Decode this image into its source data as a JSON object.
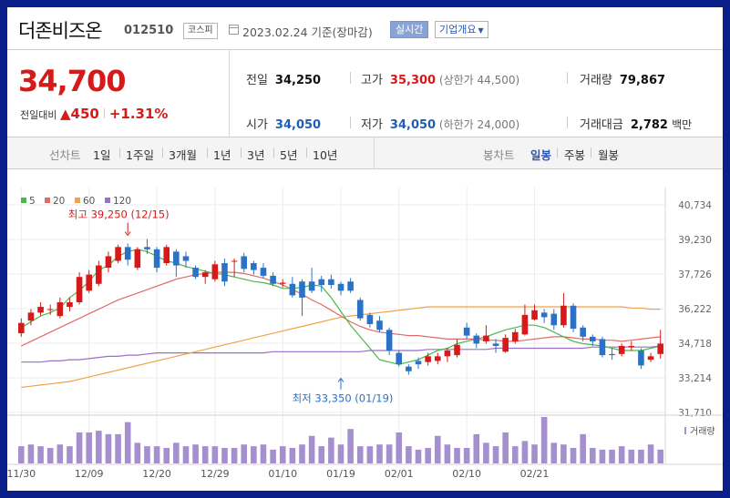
{
  "header": {
    "name": "더존비즈온",
    "code": "012510",
    "market": "코스피",
    "date_text": "2023.02.24 기준(장마감)",
    "realtime_label": "실시간",
    "company_label": "기업개요"
  },
  "quote": {
    "price": "34,700",
    "change_label": "전일대비",
    "change_arrow": "▲",
    "change_value": "450",
    "change_pct": "+1.31%",
    "prev_close_label": "전일",
    "prev_close": "34,250",
    "high_label": "고가",
    "high": "35,300",
    "upper_limit_label": "상한가",
    "upper_limit": "44,500",
    "volume_label": "거래량",
    "volume": "79,867",
    "open_label": "시가",
    "open": "34,050",
    "low_label": "저가",
    "low": "34,050",
    "lower_limit_label": "하한가",
    "lower_limit": "24,000",
    "amount_label": "거래대금",
    "amount": "2,782",
    "amount_unit": "백만"
  },
  "periods": {
    "label": "선차트",
    "items": [
      "1일",
      "1주일",
      "3개월",
      "1년",
      "3년",
      "5년",
      "10년"
    ]
  },
  "candle_periods": {
    "label": "봉차트",
    "items": [
      "일봉",
      "주봉",
      "월봉"
    ],
    "selected": "일봉"
  },
  "colors": {
    "up": "#d61a1a",
    "down": "#2b72c7",
    "ma5": "#4bb84b",
    "ma20": "#e06a6a",
    "ma60": "#f0a24a",
    "ma120": "#9a6fc8",
    "volume": "#a68fcf"
  },
  "chart_data": {
    "type": "candlestick",
    "legend": [
      {
        "name": "5",
        "color": "#4bb84b"
      },
      {
        "name": "20",
        "color": "#e06a6a"
      },
      {
        "name": "60",
        "color": "#f0a24a"
      },
      {
        "name": "120",
        "color": "#9a6fc8"
      }
    ],
    "y_ticks": [
      "40,734",
      "39,230",
      "37,726",
      "36,222",
      "34,718",
      "33,214",
      "31,710"
    ],
    "ylim": [
      31710,
      40734
    ],
    "x_ticks": [
      {
        "i": 0,
        "label": "11/30"
      },
      {
        "i": 7,
        "label": "12/09"
      },
      {
        "i": 14,
        "label": "12/20"
      },
      {
        "i": 20,
        "label": "12/29"
      },
      {
        "i": 27,
        "label": "01/10"
      },
      {
        "i": 33,
        "label": "01/19"
      },
      {
        "i": 39,
        "label": "02/01"
      },
      {
        "i": 46,
        "label": "02/10"
      },
      {
        "i": 53,
        "label": "02/21"
      }
    ],
    "annotations": [
      {
        "text": "최고 39,250 (12/15)",
        "i": 11,
        "value": 39250
      },
      {
        "text": "최저 33,350 (01/19)",
        "i": 33,
        "value": 33350
      }
    ],
    "volume_label": "거래량",
    "candles": [
      {
        "o": 35150,
        "c": 35600,
        "h": 35800,
        "l": 35000,
        "v": 10
      },
      {
        "o": 35700,
        "c": 36050,
        "h": 36200,
        "l": 35500,
        "v": 11
      },
      {
        "o": 36050,
        "c": 36300,
        "h": 36500,
        "l": 35900,
        "v": 10
      },
      {
        "o": 36200,
        "c": 36200,
        "h": 36400,
        "l": 35950,
        "v": 9
      },
      {
        "o": 35900,
        "c": 36500,
        "h": 36700,
        "l": 35800,
        "v": 11
      },
      {
        "o": 36300,
        "c": 36500,
        "h": 36700,
        "l": 36100,
        "v": 10
      },
      {
        "o": 36500,
        "c": 37600,
        "h": 37800,
        "l": 36400,
        "v": 18
      },
      {
        "o": 37000,
        "c": 37700,
        "h": 37900,
        "l": 36900,
        "v": 18
      },
      {
        "o": 37300,
        "c": 38100,
        "h": 38300,
        "l": 37200,
        "v": 19
      },
      {
        "o": 38000,
        "c": 38500,
        "h": 38700,
        "l": 37800,
        "v": 17
      },
      {
        "o": 38300,
        "c": 38900,
        "h": 39000,
        "l": 38200,
        "v": 17
      },
      {
        "o": 38900,
        "c": 38350,
        "h": 39050,
        "l": 38100,
        "v": 24
      },
      {
        "o": 38000,
        "c": 38800,
        "h": 38900,
        "l": 37900,
        "v": 12
      },
      {
        "o": 38900,
        "c": 38800,
        "h": 39250,
        "l": 38600,
        "v": 10
      },
      {
        "o": 38800,
        "c": 38000,
        "h": 38900,
        "l": 37800,
        "v": 10
      },
      {
        "o": 38200,
        "c": 38900,
        "h": 39000,
        "l": 38100,
        "v": 9
      },
      {
        "o": 38700,
        "c": 38100,
        "h": 38800,
        "l": 37600,
        "v": 12
      },
      {
        "o": 38500,
        "c": 38300,
        "h": 38700,
        "l": 38000,
        "v": 10
      },
      {
        "o": 38000,
        "c": 37600,
        "h": 38100,
        "l": 37500,
        "v": 11
      },
      {
        "o": 37600,
        "c": 37800,
        "h": 37900,
        "l": 37300,
        "v": 10
      },
      {
        "o": 37500,
        "c": 38150,
        "h": 38300,
        "l": 37400,
        "v": 10
      },
      {
        "o": 38200,
        "c": 37400,
        "h": 38400,
        "l": 37200,
        "v": 9
      },
      {
        "o": 38300,
        "c": 38300,
        "h": 38400,
        "l": 37600,
        "v": 9
      },
      {
        "o": 38500,
        "c": 37950,
        "h": 38650,
        "l": 37800,
        "v": 11
      },
      {
        "o": 38200,
        "c": 37900,
        "h": 38300,
        "l": 37700,
        "v": 10
      },
      {
        "o": 38000,
        "c": 37650,
        "h": 38200,
        "l": 37550,
        "v": 11
      },
      {
        "o": 37650,
        "c": 37300,
        "h": 37800,
        "l": 37200,
        "v": 8
      },
      {
        "o": 37300,
        "c": 37350,
        "h": 37500,
        "l": 37150,
        "v": 10
      },
      {
        "o": 37300,
        "c": 36800,
        "h": 37600,
        "l": 36700,
        "v": 9
      },
      {
        "o": 37400,
        "c": 36700,
        "h": 37500,
        "l": 35900,
        "v": 11
      },
      {
        "o": 37400,
        "c": 37000,
        "h": 38000,
        "l": 36900,
        "v": 16
      },
      {
        "o": 37500,
        "c": 37250,
        "h": 37650,
        "l": 36950,
        "v": 10
      },
      {
        "o": 37500,
        "c": 37250,
        "h": 37700,
        "l": 37100,
        "v": 15
      },
      {
        "o": 37300,
        "c": 37000,
        "h": 37400,
        "l": 36800,
        "v": 11
      },
      {
        "o": 37400,
        "c": 37000,
        "h": 37550,
        "l": 36900,
        "v": 20
      },
      {
        "o": 36600,
        "c": 35800,
        "h": 36700,
        "l": 35700,
        "v": 10
      },
      {
        "o": 35950,
        "c": 35550,
        "h": 36050,
        "l": 35400,
        "v": 10
      },
      {
        "o": 35700,
        "c": 35300,
        "h": 35900,
        "l": 35200,
        "v": 11
      },
      {
        "o": 35300,
        "c": 34400,
        "h": 35400,
        "l": 34200,
        "v": 11
      },
      {
        "o": 34300,
        "c": 33800,
        "h": 34400,
        "l": 33700,
        "v": 18
      },
      {
        "o": 33700,
        "c": 33500,
        "h": 33800,
        "l": 33350,
        "v": 10
      },
      {
        "o": 33950,
        "c": 33800,
        "h": 34100,
        "l": 33600,
        "v": 8
      },
      {
        "o": 33900,
        "c": 34150,
        "h": 34300,
        "l": 33750,
        "v": 9
      },
      {
        "o": 33950,
        "c": 34150,
        "h": 34300,
        "l": 33800,
        "v": 16
      },
      {
        "o": 34150,
        "c": 34400,
        "h": 34500,
        "l": 33900,
        "v": 11
      },
      {
        "o": 34200,
        "c": 34650,
        "h": 34900,
        "l": 34100,
        "v": 9
      },
      {
        "o": 35400,
        "c": 35050,
        "h": 35600,
        "l": 34900,
        "v": 9
      },
      {
        "o": 35050,
        "c": 34700,
        "h": 35150,
        "l": 34500,
        "v": 17
      },
      {
        "o": 34800,
        "c": 35050,
        "h": 35500,
        "l": 34700,
        "v": 12
      },
      {
        "o": 34700,
        "c": 34600,
        "h": 34900,
        "l": 34300,
        "v": 10
      },
      {
        "o": 34350,
        "c": 34950,
        "h": 35100,
        "l": 34300,
        "v": 18
      },
      {
        "o": 34800,
        "c": 35200,
        "h": 35350,
        "l": 34700,
        "v": 10
      },
      {
        "o": 35100,
        "c": 35950,
        "h": 36400,
        "l": 35050,
        "v": 13
      },
      {
        "o": 35750,
        "c": 36150,
        "h": 36400,
        "l": 35700,
        "v": 11
      },
      {
        "o": 36050,
        "c": 35850,
        "h": 36200,
        "l": 35600,
        "v": 27
      },
      {
        "o": 36000,
        "c": 35500,
        "h": 36200,
        "l": 35300,
        "v": 12
      },
      {
        "o": 35500,
        "c": 36350,
        "h": 36900,
        "l": 35400,
        "v": 11
      },
      {
        "o": 36350,
        "c": 35350,
        "h": 36450,
        "l": 35200,
        "v": 9
      },
      {
        "o": 35400,
        "c": 35000,
        "h": 35500,
        "l": 34800,
        "v": 17
      },
      {
        "o": 35000,
        "c": 34800,
        "h": 35100,
        "l": 34600,
        "v": 9
      },
      {
        "o": 34900,
        "c": 34200,
        "h": 35000,
        "l": 34100,
        "v": 8
      },
      {
        "o": 34250,
        "c": 34200,
        "h": 34500,
        "l": 34000,
        "v": 8
      },
      {
        "o": 34250,
        "c": 34600,
        "h": 34700,
        "l": 34150,
        "v": 10
      },
      {
        "o": 34550,
        "c": 34600,
        "h": 34800,
        "l": 34400,
        "v": 8
      },
      {
        "o": 34400,
        "c": 33750,
        "h": 34500,
        "l": 33600,
        "v": 8
      },
      {
        "o": 34000,
        "c": 34150,
        "h": 34300,
        "l": 33900,
        "v": 11
      },
      {
        "o": 34250,
        "c": 34700,
        "h": 35300,
        "l": 34050,
        "v": 8
      }
    ],
    "ma": {
      "ma5": [
        35400,
        35650,
        35900,
        36050,
        36250,
        36700,
        37000,
        37400,
        37900,
        38100,
        38500,
        38700,
        38800,
        38700,
        38500,
        38300,
        38200,
        38050,
        37950,
        37850,
        37750,
        37700,
        37600,
        37500,
        37400,
        37350,
        37250,
        37100,
        37100,
        37150,
        37250,
        37200,
        36700,
        36100,
        35500,
        35000,
        34500,
        34000,
        33900,
        33800,
        33900,
        34000,
        34200,
        34400,
        34500,
        34700,
        34800,
        34900,
        35000,
        35150,
        35300,
        35400,
        35500,
        35500,
        35400,
        35200,
        35000,
        34800,
        34700,
        34650,
        34600,
        34500,
        34400,
        34400,
        34400,
        34500,
        34600
      ],
      "ma20": [
        34600,
        34800,
        35000,
        35200,
        35400,
        35600,
        35800,
        36000,
        36200,
        36400,
        36600,
        36750,
        36900,
        37050,
        37200,
        37350,
        37500,
        37600,
        37700,
        37750,
        37800,
        37800,
        37800,
        37750,
        37650,
        37550,
        37400,
        37250,
        37050,
        36850,
        36600,
        36400,
        36150,
        35900,
        35650,
        35450,
        35300,
        35200,
        35150,
        35100,
        35050,
        35050,
        35000,
        34950,
        34900,
        34900,
        34900,
        34900,
        34850,
        34850,
        34800,
        34800,
        34850,
        34900,
        34950,
        35000,
        35000,
        34950,
        34900,
        34900,
        34850,
        34850,
        34800,
        34850,
        34900,
        34950,
        35000
      ],
      "ma60": [
        32800,
        32850,
        32900,
        32950,
        33000,
        33050,
        33150,
        33250,
        33350,
        33450,
        33550,
        33650,
        33750,
        33850,
        33950,
        34050,
        34150,
        34250,
        34350,
        34450,
        34550,
        34650,
        34750,
        34850,
        34950,
        35050,
        35150,
        35250,
        35350,
        35450,
        35550,
        35650,
        35750,
        35850,
        35900,
        35950,
        36000,
        36050,
        36100,
        36150,
        36200,
        36250,
        36300,
        36300,
        36300,
        36300,
        36300,
        36300,
        36300,
        36300,
        36300,
        36300,
        36300,
        36300,
        36300,
        36300,
        36300,
        36300,
        36300,
        36300,
        36300,
        36300,
        36300,
        36250,
        36250,
        36200,
        36200
      ],
      "ma120": [
        33900,
        33900,
        33900,
        33950,
        33950,
        34000,
        34000,
        34050,
        34100,
        34150,
        34150,
        34200,
        34200,
        34250,
        34300,
        34300,
        34300,
        34300,
        34300,
        34300,
        34300,
        34300,
        34300,
        34300,
        34300,
        34300,
        34350,
        34350,
        34350,
        34350,
        34350,
        34350,
        34350,
        34350,
        34350,
        34350,
        34400,
        34400,
        34400,
        34400,
        34400,
        34400,
        34450,
        34450,
        34450,
        34450,
        34450,
        34450,
        34450,
        34500,
        34500,
        34500,
        34500,
        34500,
        34500,
        34500,
        34500,
        34500,
        34500,
        34550,
        34550,
        34550,
        34550,
        34550,
        34550,
        34550,
        34600
      ]
    }
  }
}
